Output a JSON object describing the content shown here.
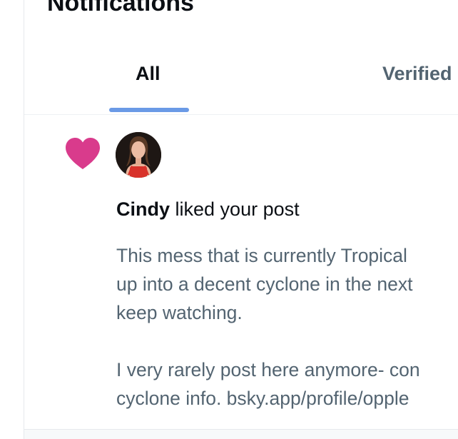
{
  "header": {
    "title": "Notifications"
  },
  "tabs": [
    {
      "label": "All",
      "selected": true
    },
    {
      "label": "Verified",
      "selected": false
    }
  ],
  "colors": {
    "accent": "#6a9ae6",
    "heart": "#d93b8c",
    "text_primary": "#0b0f14",
    "text_secondary": "#536471"
  },
  "notification": {
    "icon": "heart-icon",
    "actor_name": "Cindy",
    "action_text": " liked your post",
    "post_lines": [
      "This mess that is currently Tropical",
      "up into a decent cyclone in the next",
      "keep watching.",
      "",
      "I very rarely post here anymore- con",
      "cyclone info. bsky.app/profile/opple"
    ]
  }
}
